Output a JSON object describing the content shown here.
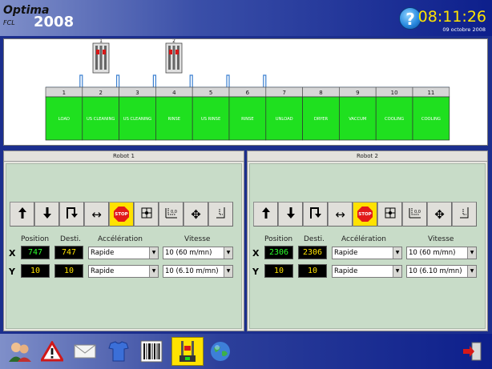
{
  "header": {
    "app_name": "Optima",
    "app_sub": "FCL",
    "year": "2008",
    "help_icon": "?",
    "time": "08:11:26",
    "date": "09 octobre 2008"
  },
  "line": {
    "stations": [
      {
        "num": "1",
        "label": "LOAD"
      },
      {
        "num": "2",
        "label": "US CLEANING"
      },
      {
        "num": "3",
        "label": "US CLEANING"
      },
      {
        "num": "4",
        "label": "RINSE"
      },
      {
        "num": "5",
        "label": "US RINSE"
      },
      {
        "num": "6",
        "label": "RINSE"
      },
      {
        "num": "7",
        "label": "UNLOAD"
      },
      {
        "num": "8",
        "label": "DRYER"
      },
      {
        "num": "9",
        "label": "VACCUM"
      },
      {
        "num": "10",
        "label": "COOLING"
      },
      {
        "num": "11",
        "label": "COOLING"
      }
    ],
    "robot_markers": [
      "1",
      "2"
    ],
    "station_color": "#1fe01f"
  },
  "robots": [
    {
      "title": "Robot 1",
      "headers": {
        "position": "Position",
        "desti": "Desti.",
        "accel": "Accélération",
        "vitesse": "Vitesse"
      },
      "x": {
        "axis": "X",
        "position": "747",
        "desti": "747",
        "accel": "Rapide",
        "vitesse": "10 (60 m/mn)"
      },
      "y": {
        "axis": "Y",
        "position": "10",
        "desti": "10",
        "accel": "Rapide",
        "vitesse": "10 (6.10 m/mn)"
      },
      "stop_label": "STOP"
    },
    {
      "title": "Robot 2",
      "headers": {
        "position": "Position",
        "desti": "Desti.",
        "accel": "Accélération",
        "vitesse": "Vitesse"
      },
      "x": {
        "axis": "X",
        "position": "2306",
        "desti": "2306",
        "accel": "Rapide",
        "vitesse": "10 (60 m/mn)"
      },
      "y": {
        "axis": "Y",
        "position": "10",
        "desti": "10",
        "accel": "Rapide",
        "vitesse": "10 (6.10 m/mn)"
      },
      "stop_label": "STOP"
    }
  ],
  "toolbar_icons": [
    "arrow-up-icon",
    "arrow-down-icon",
    "arrow-down-right-icon",
    "arrow-left-right-icon",
    "stop-icon",
    "grid-target-icon",
    "xy-zero-icon",
    "move-cross-icon",
    "axis-reset-icon"
  ],
  "footer_icons": [
    "users-icon",
    "warning-icon",
    "mail-icon",
    "shirt-icon",
    "barcode-icon",
    "robot-control-icon",
    "globe-icon",
    "exit-door-icon"
  ],
  "colors": {
    "accent_yellow": "#ffe200",
    "lcd_green": "#2cff2c",
    "lcd_yellow": "#ffe400",
    "panel_green": "#c8dcc8"
  }
}
